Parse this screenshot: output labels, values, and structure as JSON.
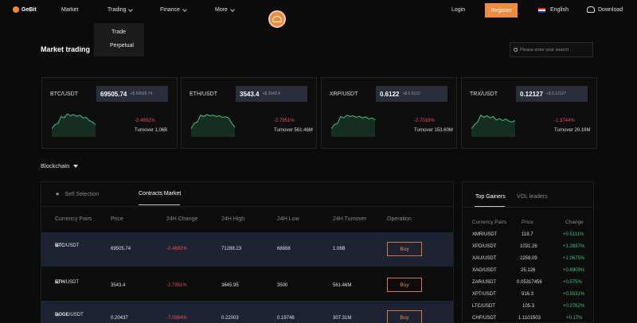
{
  "header": {
    "logo_text": "GeBit",
    "nav": [
      {
        "label": "Market"
      },
      {
        "label": "Trading"
      },
      {
        "label": "Finance"
      },
      {
        "label": "More"
      }
    ],
    "login": "Login",
    "register": "Register",
    "language": "English",
    "download": "Download",
    "accent": "#f08a3c"
  },
  "trading_menu": [
    "Trade",
    "Perpetual"
  ],
  "main": {
    "title": "Market trading",
    "search_placeholder": "Please enter your search",
    "cards": [
      {
        "pair": "BTC/USDT",
        "price": "69505.74",
        "change": "+$ 69505.74",
        "pct": "-2.4892%",
        "turnover": "Turnover 1.06B",
        "trend": [
          0.3,
          0.45,
          0.5,
          0.75,
          0.7,
          0.85,
          0.78,
          0.82,
          0.76,
          0.8,
          0.7,
          0.72,
          0.6,
          0.55,
          0.45
        ]
      },
      {
        "pair": "ETH/USDT",
        "price": "3543.4",
        "change": "+$ 3543.4",
        "pct": "-2.7951%",
        "turnover": "Turnover 561.46M",
        "trend": [
          0.3,
          0.5,
          0.55,
          0.8,
          0.75,
          0.82,
          0.78,
          0.8,
          0.75,
          0.78,
          0.72,
          0.74,
          0.7,
          0.5,
          0.35
        ]
      },
      {
        "pair": "XRP/USDT",
        "price": "0.6122",
        "change": "+$ 0.6122",
        "pct": "-2.7018%",
        "turnover": "Turnover 153.60M",
        "trend": [
          0.3,
          0.45,
          0.5,
          0.75,
          0.7,
          0.8,
          0.75,
          0.78,
          0.72,
          0.76,
          0.7,
          0.74,
          0.66,
          0.7,
          0.62
        ]
      },
      {
        "pair": "TRX/USDT",
        "price": "0.12127",
        "change": "+$ 0.12127",
        "pct": "-1.3744%",
        "turnover": "Turnover 20.19M",
        "trend": [
          0.3,
          0.45,
          0.55,
          0.8,
          0.72,
          0.78,
          0.7,
          0.75,
          0.62,
          0.68,
          0.6,
          0.66,
          0.58,
          0.55,
          0.6
        ]
      }
    ],
    "category": "Blockchain"
  },
  "table": {
    "tabs": [
      "Self Selection",
      "Contracts Market"
    ],
    "columns": [
      "Currency Pairs",
      "Price",
      "24H Change",
      "24H High",
      "24H Low",
      "24H Turnover",
      "Operation"
    ],
    "rows": [
      {
        "base": "BTC",
        "quote": "/USDT",
        "price": "69505.74",
        "change": "-2.4892%",
        "high": "71288.23",
        "low": "68888",
        "turnover": "1.06B",
        "action": "Buy"
      },
      {
        "base": "ETH",
        "quote": "/USDT",
        "price": "3543.4",
        "change": "-2.7951%",
        "high": "3645.95",
        "low": "3500",
        "turnover": "561.46M",
        "action": "Buy"
      },
      {
        "base": "DOGE",
        "quote": "/USDT",
        "price": "0.20437",
        "change": "-7.0884%",
        "high": "0.22003",
        "low": "0.19746",
        "turnover": "307.31M",
        "action": "Buy"
      }
    ]
  },
  "gainers": {
    "tabs": [
      "Top Gainers",
      "VOL leaders"
    ],
    "columns": [
      "Currency Pairs",
      "Price",
      "Change"
    ],
    "rows": [
      {
        "pair": "XMR/USDT",
        "price": "118.7",
        "change": "+0.5111%"
      },
      {
        "pair": "XPD/USDT",
        "price": "1031.26",
        "change": "+1.2837%"
      },
      {
        "pair": "XAU/USDT",
        "price": "2258.09",
        "change": "+1.0675%"
      },
      {
        "pair": "XAG/USDT",
        "price": "25.126",
        "change": "+0.6909%"
      },
      {
        "pair": "ZAR/USDT",
        "price": "0.05317456",
        "change": "+0.575%"
      },
      {
        "pair": "XPT/USDT",
        "price": "916.3",
        "change": "+0.5531%"
      },
      {
        "pair": "LTC/USDT",
        "price": "105.3",
        "change": "+0.2762%"
      },
      {
        "pair": "CHF/USDT",
        "price": "1.1101503",
        "change": "+0.17%"
      }
    ]
  }
}
